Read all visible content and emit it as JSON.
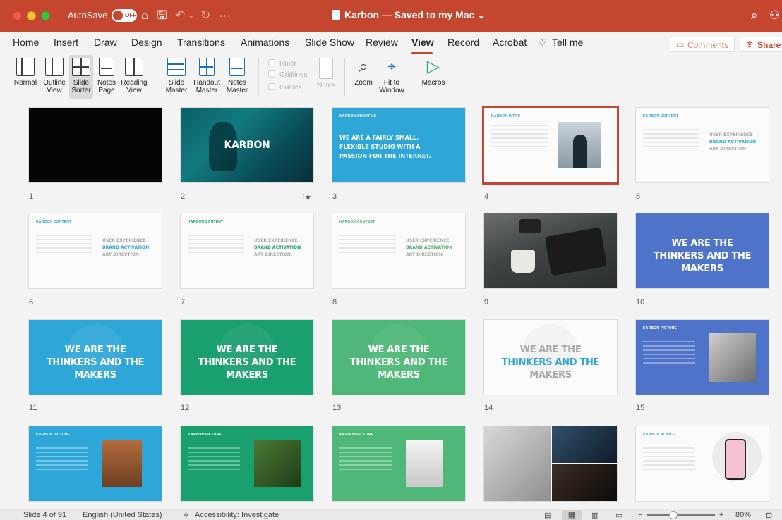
{
  "titlebar": {
    "autosave_label": "AutoSave",
    "autosave_state": "OFF",
    "doc_title": "Karbon — Saved to my Mac",
    "bg_color": "#c5462e"
  },
  "tabs": [
    "Home",
    "Insert",
    "Draw",
    "Design",
    "Transitions",
    "Animations",
    "Slide Show",
    "Review",
    "View",
    "Record",
    "Acrobat",
    "Tell me"
  ],
  "active_tab": "View",
  "comments_label": "Comments",
  "share_label": "Share",
  "ribbon": {
    "normal": "Normal",
    "outline": [
      "Outline",
      "View"
    ],
    "slide_sorter": [
      "Slide",
      "Sorter"
    ],
    "notes_page": [
      "Notes",
      "Page"
    ],
    "reading_view": [
      "Reading",
      "View"
    ],
    "slide_master": [
      "Slide",
      "Master"
    ],
    "handout_master": [
      "Handout",
      "Master"
    ],
    "notes_master": [
      "Notes",
      "Master"
    ],
    "ruler": "Ruler",
    "gridlines": "Gridlines",
    "guides": "Guides",
    "notes": "Notes",
    "zoom": "Zoom",
    "fit_to_window": [
      "Fit to",
      "Window"
    ],
    "macros": "Macros"
  },
  "slides": [
    {
      "num": "1"
    },
    {
      "num": "2",
      "title": "KARBON",
      "badge": "⁝★"
    },
    {
      "num": "3",
      "kicker": "KARBON ABOUT US",
      "title": [
        "WE ARE A FAIRLY SMALL,",
        "FLEXIBLE STUDIO WITH A",
        "PASSION FOR THE INTERNET."
      ]
    },
    {
      "num": "4",
      "kicker": "KARBON INTRO"
    },
    {
      "num": "5",
      "kicker": "KARBON CONTENT",
      "lines": [
        "USER EXPERIENCE",
        "BRAND ACTIVATION",
        "ART DIRECTION"
      ]
    },
    {
      "num": "6",
      "kicker": "KARBON CONTENT",
      "lines": [
        "USER EXPERIENCE",
        "BRAND ACTIVATION",
        "ART DIRECTION"
      ]
    },
    {
      "num": "7",
      "kicker": "KARBON CONTENT",
      "lines": [
        "USER EXPERIENCE",
        "BRAND ACTIVATION",
        "ART DIRECTION"
      ]
    },
    {
      "num": "8",
      "kicker": "KARBON CONTENT",
      "lines": [
        "USER EXPERIENCE",
        "BRAND ACTIVATION",
        "ART DIRECTION"
      ]
    },
    {
      "num": "9"
    },
    {
      "num": "10",
      "title": [
        "WE ARE THE",
        "THINKERS AND THE",
        "MAKERS"
      ]
    },
    {
      "num": "11",
      "title": [
        "WE ARE THE",
        "THINKERS AND THE",
        "MAKERS"
      ]
    },
    {
      "num": "12",
      "title": [
        "WE ARE THE",
        "THINKERS AND THE",
        "MAKERS"
      ]
    },
    {
      "num": "13",
      "title": [
        "WE ARE THE",
        "THINKERS AND THE",
        "MAKERS"
      ]
    },
    {
      "num": "14",
      "title": [
        "WE ARE THE",
        "THINKERS AND THE",
        "MAKERS"
      ]
    },
    {
      "num": "15",
      "kicker": "KARBON PICTURE"
    },
    {
      "kicker": "KARBON PICTURE"
    },
    {
      "kicker": "KARBON PICTURE"
    },
    {
      "kicker": "KARBON PICTURE"
    },
    {},
    {
      "kicker": "KARBON MOBILE"
    }
  ],
  "status": {
    "slide_info": "Slide 4 of 91",
    "language": "English (United States)",
    "accessibility": "Accessibility: Investigate",
    "zoom": "80%"
  }
}
